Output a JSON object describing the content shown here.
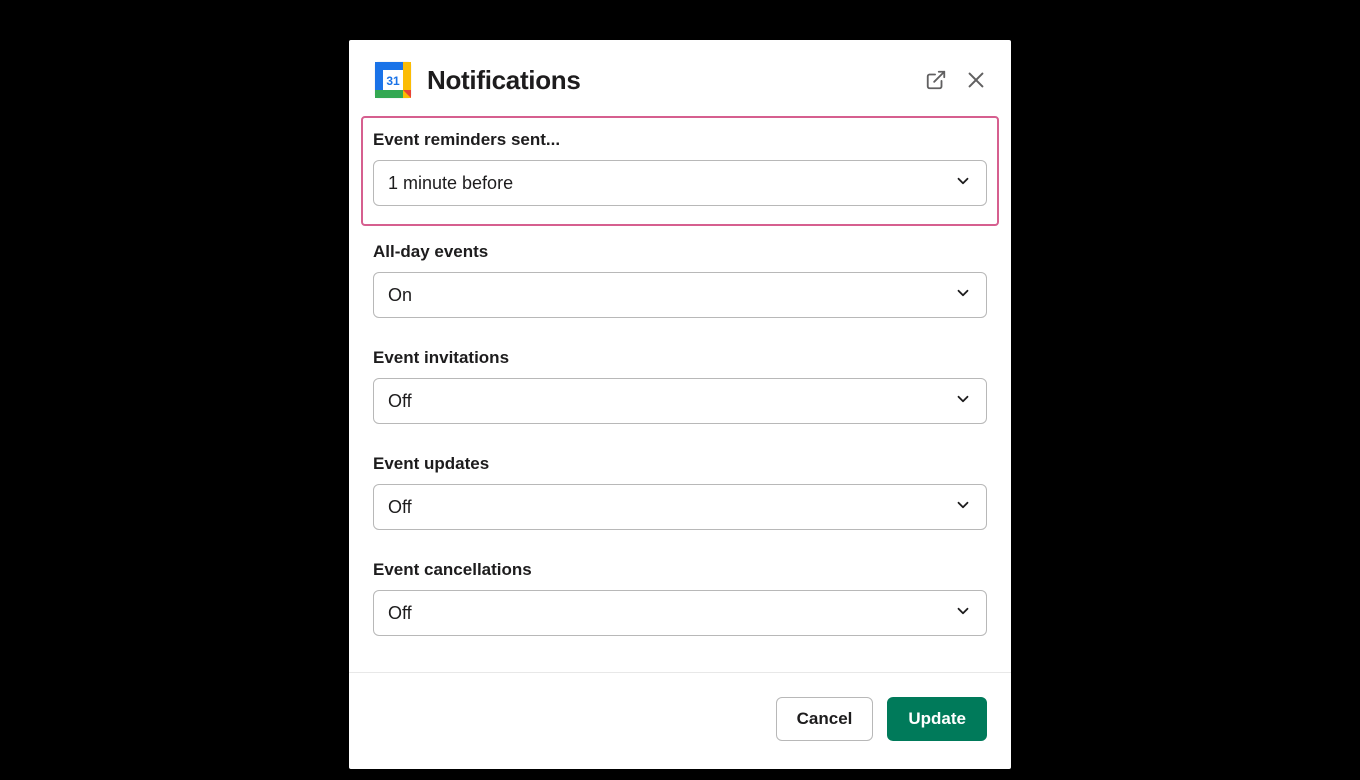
{
  "dialog": {
    "title": "Notifications",
    "icon": "google-calendar",
    "calendar_day": "31"
  },
  "fields": {
    "event_reminders": {
      "label": "Event reminders sent...",
      "value": "1 minute before",
      "highlighted": true
    },
    "all_day_events": {
      "label": "All-day events",
      "value": "On"
    },
    "event_invitations": {
      "label": "Event invitations",
      "value": "Off"
    },
    "event_updates": {
      "label": "Event updates",
      "value": "Off"
    },
    "event_cancellations": {
      "label": "Event cancellations",
      "value": "Off"
    }
  },
  "actions": {
    "cancel": "Cancel",
    "update": "Update"
  },
  "colors": {
    "highlight_border": "#d65f8f",
    "primary_button": "#007a5a"
  }
}
